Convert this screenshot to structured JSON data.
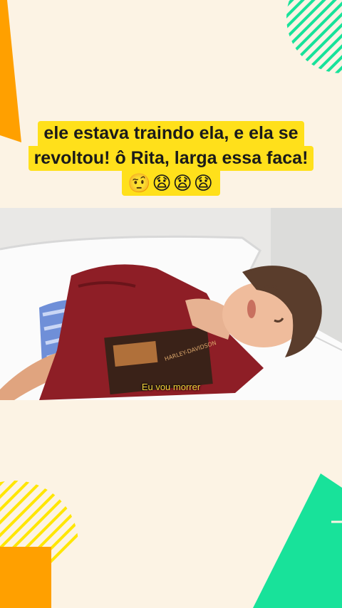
{
  "caption": {
    "line1": "ele estava traindo ela, e ela se",
    "line2": "revoltou! ô Rita, larga essa faca!",
    "line3": "🤨😧😧😧"
  },
  "video": {
    "subtitle": "Eu vou morrer",
    "shirt_print": "HARLEY-DAVIDSON"
  },
  "colors": {
    "background": "#fcf3e4",
    "caption_highlight": "#ffe01b",
    "accent_orange": "#ffa000",
    "accent_green": "#18e29a",
    "accent_yellow": "#ffe600"
  }
}
